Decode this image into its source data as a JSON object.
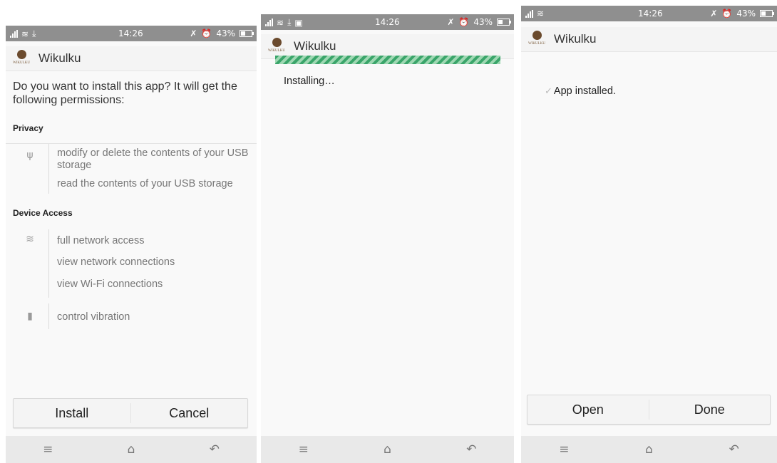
{
  "status": {
    "time": "14:26",
    "battery": "43%",
    "icons": [
      "signal-icon",
      "wifi-icon",
      "download-icon",
      "image-icon",
      "mute-icon",
      "alarm-icon",
      "battery-icon"
    ]
  },
  "app": {
    "name": "Wikulku",
    "logo_text": "WIKULKU"
  },
  "screen1": {
    "prompt": "Do you want to install this app? It will get the following permissions:",
    "privacy": {
      "heading": "Privacy",
      "permissions": [
        "modify or delete the contents of your USB storage",
        "read the contents of your USB storage"
      ]
    },
    "device_access": {
      "heading": "Device Access",
      "network": [
        "full network access",
        "view network connections",
        "view Wi-Fi connections"
      ],
      "vibration": [
        "control vibration"
      ]
    },
    "install_label": "Install",
    "cancel_label": "Cancel"
  },
  "screen2": {
    "status_text": "Installing…",
    "progress": "indeterminate"
  },
  "screen3": {
    "status_text": "App installed.",
    "open_label": "Open",
    "done_label": "Done"
  },
  "navbar": {
    "menu": "≡",
    "home": "⌂",
    "back": "↶"
  },
  "colors": {
    "statusbar": "#8f8f8f",
    "progress": "#3aa56a",
    "navbar": "#e9e9e9"
  }
}
